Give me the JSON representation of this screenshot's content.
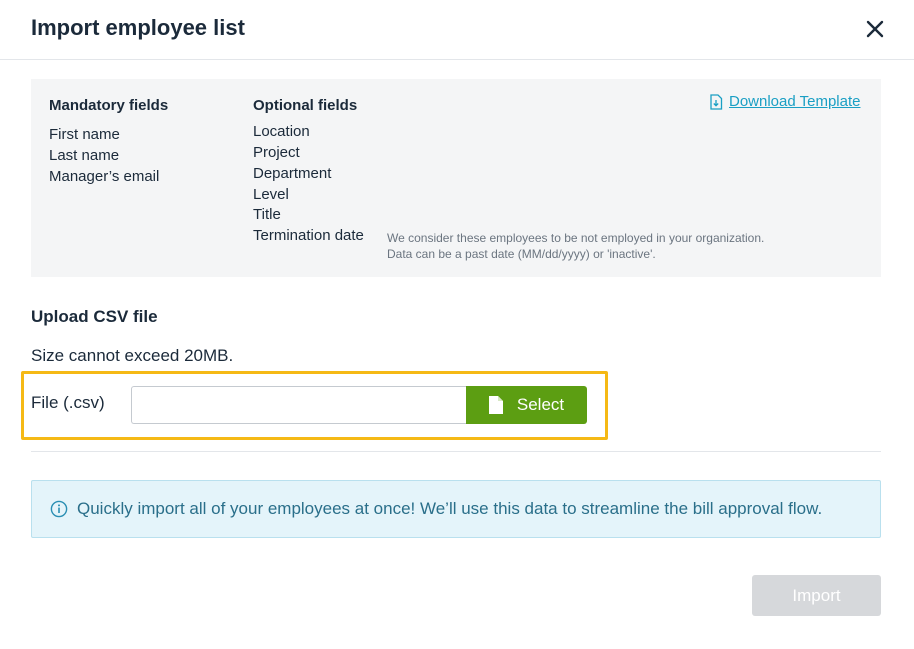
{
  "dialog": {
    "title": "Import employee list",
    "close_icon": "close-icon"
  },
  "fields": {
    "mandatory": {
      "heading": "Mandatory fields",
      "items": [
        "First name",
        "Last name",
        "Manager’s email"
      ]
    },
    "optional": {
      "heading": "Optional fields",
      "items": [
        "Location",
        "Project",
        "Department",
        "Level",
        "Title",
        "Termination date"
      ],
      "termination_note_line1": "We consider these employees to be not employed in your organization.",
      "termination_note_line2": "Data can be a past date (MM/dd/yyyy) or 'inactive'."
    },
    "download": {
      "label": "Download Template",
      "icon": "download-file-icon"
    }
  },
  "upload": {
    "title": "Upload CSV file",
    "size_note": "Size cannot exceed 20MB.",
    "file_label": "File (.csv)",
    "file_value": "",
    "select_label": "Select",
    "select_icon": "file-icon"
  },
  "info": {
    "icon": "info-icon",
    "text": "Quickly import all of your employees at once! We’ll use this data to streamline the bill approval flow."
  },
  "footer": {
    "import_label": "Import"
  },
  "colors": {
    "accent_green": "#5c9e12",
    "link": "#1a9fc4",
    "highlight": "#f5b915",
    "info_bg": "#e4f4fa",
    "disabled": "#d6d8db"
  }
}
